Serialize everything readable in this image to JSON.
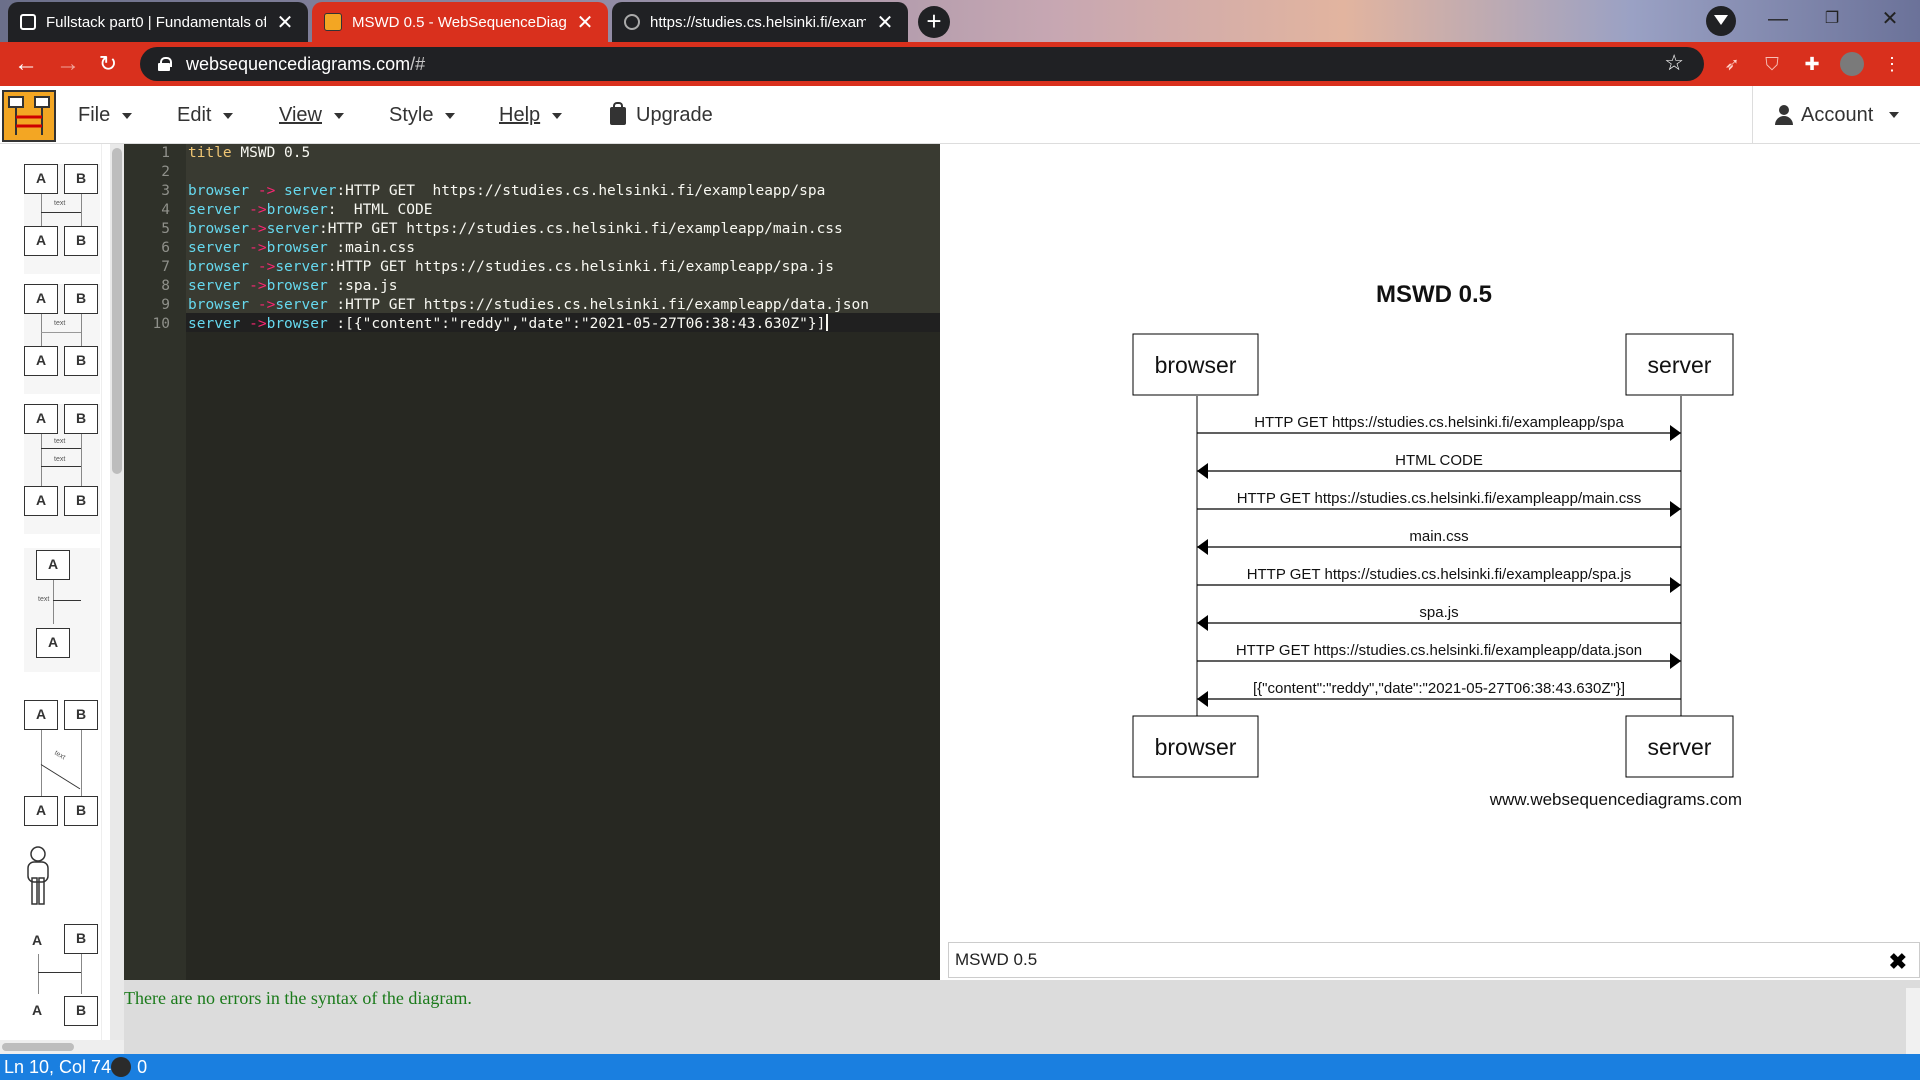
{
  "browser": {
    "tabs": [
      {
        "title": "Fullstack part0 | Fundamentals of",
        "active": false
      },
      {
        "title": "MSWD 0.5 - WebSequenceDiagra",
        "active": true
      },
      {
        "title": "https://studies.cs.helsinki.fi/exam",
        "active": false
      }
    ],
    "address": {
      "host": "websequencediagrams.com",
      "path": "/#"
    },
    "colors": {
      "accent": "#d9301d",
      "dark": "#202124"
    }
  },
  "menu": {
    "items": [
      "File",
      "Edit",
      "View",
      "Style",
      "Help"
    ],
    "upgrade": "Upgrade",
    "account": "Account"
  },
  "palette": {
    "labels": {
      "a": "A",
      "b": "B",
      "text": "text"
    }
  },
  "editor": {
    "lines": [
      {
        "n": "1",
        "text": "title MSWD 0.5"
      },
      {
        "n": "2",
        "text": ""
      },
      {
        "n": "3",
        "text": "browser -> server:HTTP GET  https://studies.cs.helsinki.fi/exampleapp/spa"
      },
      {
        "n": "4",
        "text": "server ->browser:  HTML CODE"
      },
      {
        "n": "5",
        "text": "browser->server:HTTP GET https://studies.cs.helsinki.fi/exampleapp/main.css"
      },
      {
        "n": "6",
        "text": "server ->browser :main.css"
      },
      {
        "n": "7",
        "text": "browser ->server:HTTP GET https://studies.cs.helsinki.fi/exampleapp/spa.js"
      },
      {
        "n": "8",
        "text": "server ->browser :spa.js"
      },
      {
        "n": "9",
        "text": "browser ->server :HTTP GET https://studies.cs.helsinki.fi/exampleapp/data.json"
      },
      {
        "n": "10",
        "text": "server ->browser :[{\"content\":\"reddy\",\"date\":\"2021-05-27T06:38:43.630Z\"}]"
      }
    ]
  },
  "diagram": {
    "title": "MSWD 0.5",
    "participants": [
      "browser",
      "server"
    ],
    "messages": [
      {
        "from": "browser",
        "to": "server",
        "label": "HTTP GET  https://studies.cs.helsinki.fi/exampleapp/spa"
      },
      {
        "from": "server",
        "to": "browser",
        "label": "HTML CODE"
      },
      {
        "from": "browser",
        "to": "server",
        "label": "HTTP GET https://studies.cs.helsinki.fi/exampleapp/main.css"
      },
      {
        "from": "server",
        "to": "browser",
        "label": "main.css"
      },
      {
        "from": "browser",
        "to": "server",
        "label": "HTTP GET https://studies.cs.helsinki.fi/exampleapp/spa.js"
      },
      {
        "from": "server",
        "to": "browser",
        "label": "spa.js"
      },
      {
        "from": "browser",
        "to": "server",
        "label": "HTTP GET https://studies.cs.helsinki.fi/exampleapp/data.json"
      },
      {
        "from": "server",
        "to": "browser",
        "label": "[{\"content\":\"reddy\",\"date\":\"2021-05-27T06:38:43.630Z\"}]"
      }
    ],
    "watermark": "www.websequencediagrams.com"
  },
  "title_field": {
    "value": "MSWD 0.5",
    "close": "✖"
  },
  "errors": {
    "message": "There are no errors in the syntax of the diagram."
  },
  "status": {
    "position": "Ln 10, Col 74",
    "count": "0"
  }
}
